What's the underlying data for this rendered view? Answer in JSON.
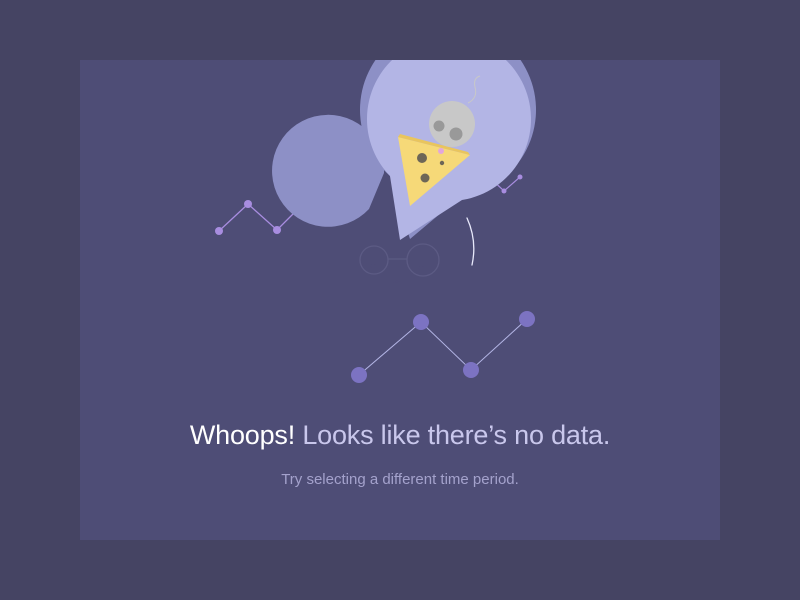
{
  "empty_state": {
    "title_emphasis": "Whoops!",
    "title_rest": " Looks like there’s no data.",
    "subtitle": "Try selecting a different time period."
  },
  "illustration": {
    "icons": [
      "pie-chart-character-icon",
      "cheese-slice-icon",
      "mouse-icon",
      "glasses-icon",
      "line-graph-icon"
    ]
  },
  "colors": {
    "page_background": "#454463",
    "card_background": "#4e4d76",
    "pie": "#b3b5e5",
    "pie_shadow": "#8d90c6",
    "cheese": "#f6d978",
    "mouse": "#c8c8c8",
    "line_small": "#a88de0",
    "line_large": "#7c73c2"
  }
}
